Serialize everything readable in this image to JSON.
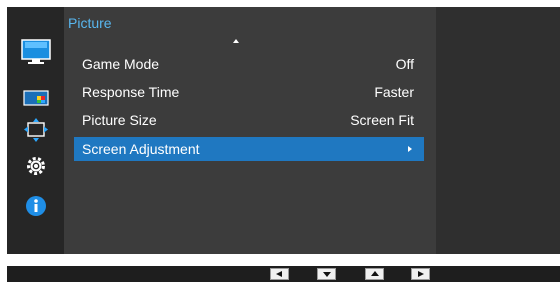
{
  "menu": {
    "title": "Picture",
    "items": [
      {
        "label": "Game Mode",
        "value": "Off"
      },
      {
        "label": "Response Time",
        "value": "Faster"
      },
      {
        "label": "Picture Size",
        "value": "Screen Fit"
      },
      {
        "label": "Screen Adjustment",
        "value": "",
        "selected": true
      }
    ]
  },
  "sidebar_icons": [
    "monitor-icon",
    "color-icon",
    "size-position-icon",
    "settings-gear-icon",
    "information-icon"
  ],
  "nav_buttons": [
    "left-arrow",
    "down-arrow",
    "up-arrow",
    "right-arrow"
  ],
  "colors": {
    "accent": "#58b6ee",
    "selection": "#1f78c1",
    "panel": "#3c3c3c",
    "rail": "#262626"
  }
}
